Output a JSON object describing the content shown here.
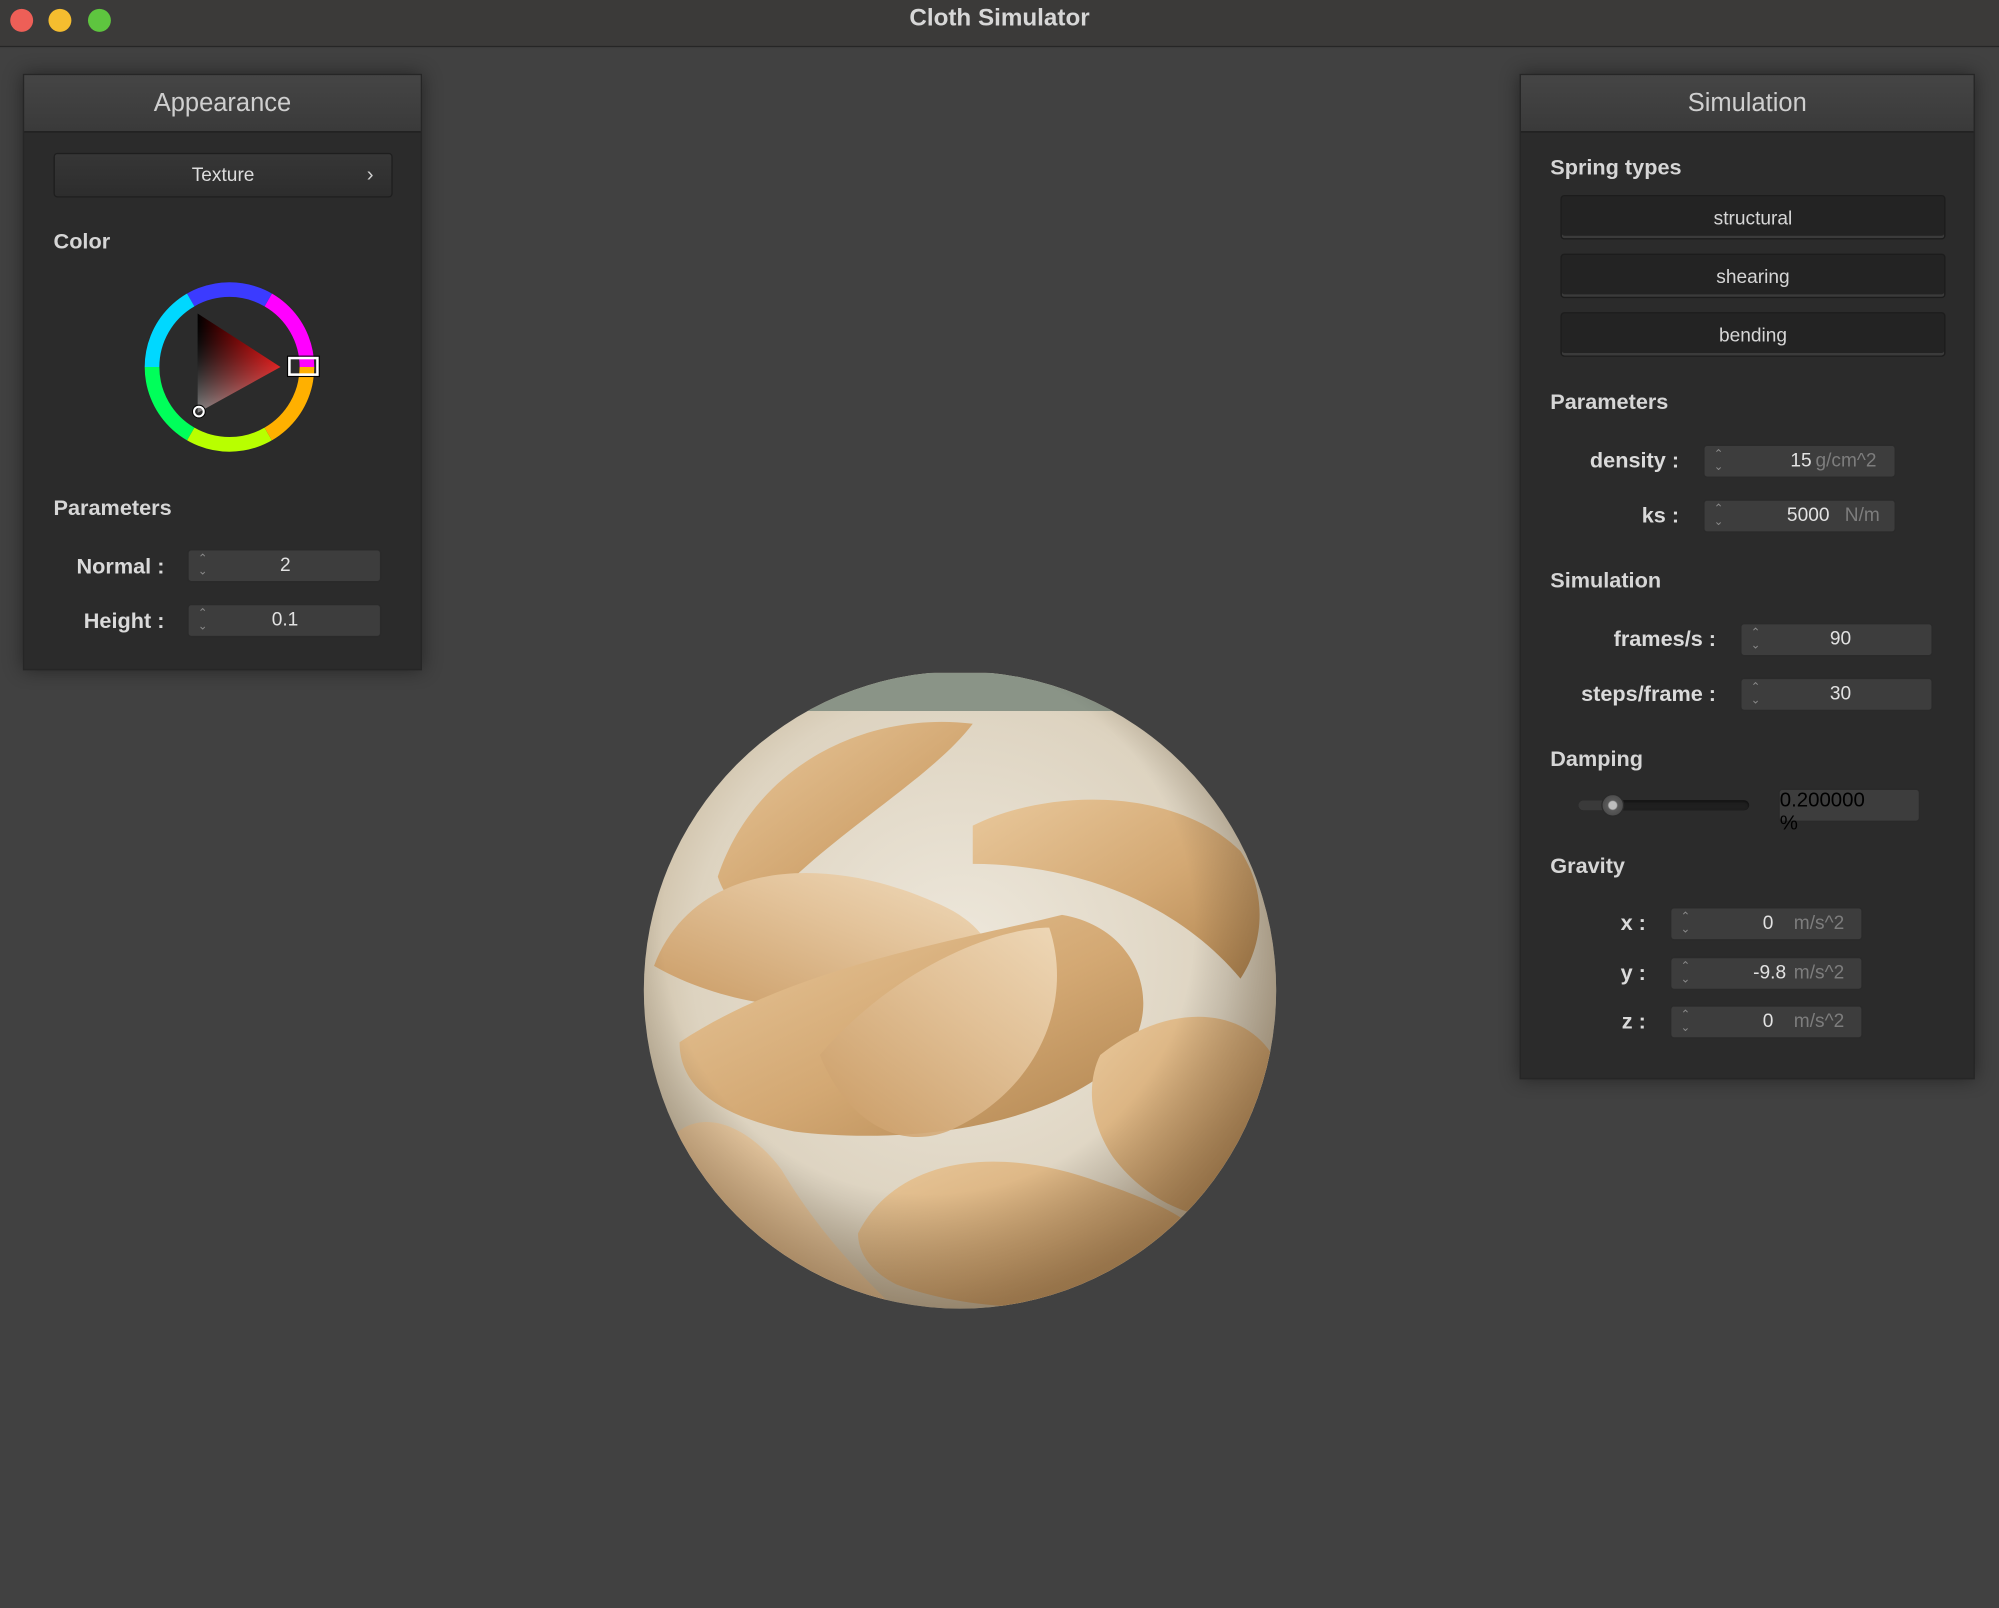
{
  "window": {
    "title": "Cloth Simulator"
  },
  "appearance": {
    "title": "Appearance",
    "texture_label": "Texture",
    "texture_chevron": "›",
    "color_label": "Color",
    "selected_color": "#ff0000",
    "params_label": "Parameters",
    "normal": {
      "label": "Normal :",
      "value": "2"
    },
    "height": {
      "label": "Height :",
      "value": "0.1"
    }
  },
  "simulation": {
    "title": "Simulation",
    "spring_label": "Spring types",
    "springs": [
      "structural",
      "shearing",
      "bending"
    ],
    "params_label": "Parameters",
    "density": {
      "label": "density :",
      "value": "15",
      "unit": "g/cm^2"
    },
    "ks": {
      "label": "ks :",
      "value": "5000",
      "unit": "N/m"
    },
    "sim_label": "Simulation",
    "fps": {
      "label": "frames/s :",
      "value": "90"
    },
    "steps": {
      "label": "steps/frame :",
      "value": "30"
    },
    "damping_label": "Damping",
    "damping": {
      "value": "0.200000",
      "unit": "%",
      "slider_fraction": 0.2
    },
    "gravity_label": "Gravity",
    "gx": {
      "label": "x :",
      "value": "0",
      "unit": "m/s^2"
    },
    "gy": {
      "label": "y :",
      "value": "-9.8",
      "unit": "m/s^2"
    },
    "gz": {
      "label": "z :",
      "value": "0",
      "unit": "m/s^2"
    }
  },
  "icons": {
    "close": "close-window-icon",
    "minimize": "minimize-window-icon",
    "maximize": "maximize-window-icon",
    "stepper": "stepper-arrows-icon"
  }
}
